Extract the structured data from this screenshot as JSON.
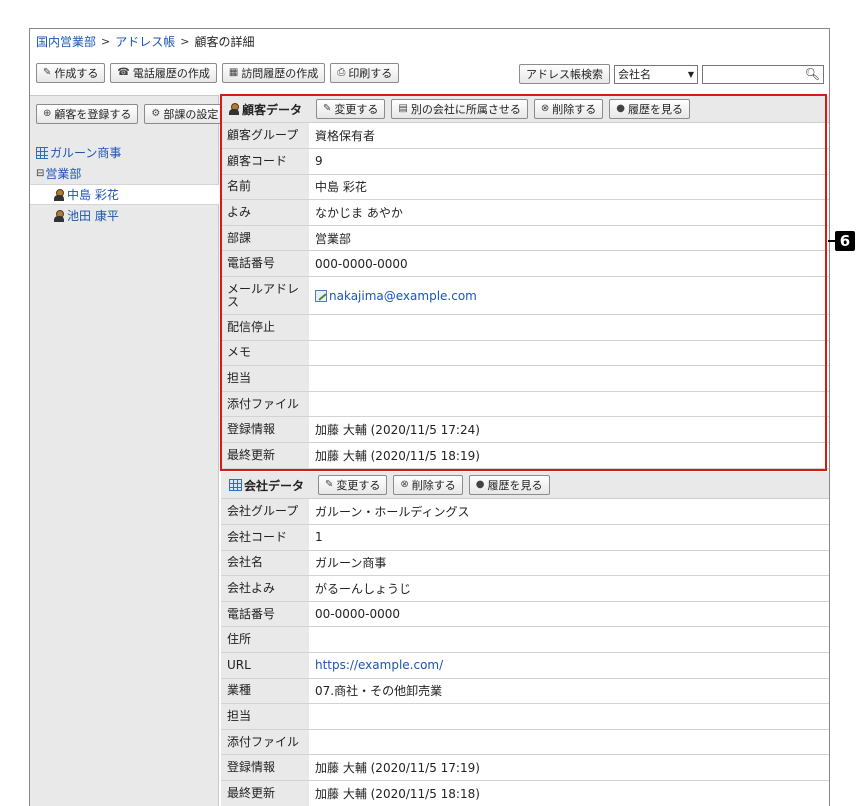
{
  "breadcrumb": {
    "items": [
      "国内営業部",
      "アドレス帳"
    ],
    "current": "顧客の詳細"
  },
  "toolbar": {
    "create": "作成する",
    "phone_history": "電話履歴の作成",
    "visit_history": "訪問履歴の作成",
    "print": "印刷する"
  },
  "search": {
    "button": "アドレス帳検索",
    "select_value": "会社名",
    "input_value": ""
  },
  "sidebar": {
    "register_customer": "顧客を登録する",
    "department_settings": "部課の設定",
    "tree": {
      "company": "ガルーン商事",
      "department": "営業部",
      "people": [
        "中島 彩花",
        "池田 康平"
      ]
    }
  },
  "customer": {
    "title": "顧客データ",
    "buttons": {
      "edit": "変更する",
      "move": "別の会社に所属させる",
      "delete": "削除する",
      "history": "履歴を見る"
    },
    "fields": [
      {
        "label": "顧客グループ",
        "value": "資格保有者"
      },
      {
        "label": "顧客コード",
        "value": "9"
      },
      {
        "label": "名前",
        "value": "中島 彩花"
      },
      {
        "label": "よみ",
        "value": "なかじま あやか"
      },
      {
        "label": "部課",
        "value": "営業部"
      },
      {
        "label": "電話番号",
        "value": "000-0000-0000"
      },
      {
        "label": "メールアドレス",
        "value": "nakajima@example.com"
      },
      {
        "label": "配信停止",
        "value": ""
      },
      {
        "label": "メモ",
        "value": ""
      },
      {
        "label": "担当",
        "value": ""
      },
      {
        "label": "添付ファイル",
        "value": ""
      },
      {
        "label": "登録情報",
        "value": "加藤 大輔 (2020/11/5 17:24)"
      },
      {
        "label": "最終更新",
        "value": "加藤 大輔 (2020/11/5 18:19)"
      }
    ]
  },
  "company": {
    "title": "会社データ",
    "buttons": {
      "edit": "変更する",
      "delete": "削除する",
      "history": "履歴を見る"
    },
    "fields": [
      {
        "label": "会社グループ",
        "value": "ガルーン・ホールディングス"
      },
      {
        "label": "会社コード",
        "value": "1"
      },
      {
        "label": "会社名",
        "value": "ガルーン商事"
      },
      {
        "label": "会社よみ",
        "value": "がるーんしょうじ"
      },
      {
        "label": "電話番号",
        "value": "00-0000-0000"
      },
      {
        "label": "住所",
        "value": ""
      },
      {
        "label": "URL",
        "value": "https://example.com/"
      },
      {
        "label": "業種",
        "value": "07.商社・その他卸売業"
      },
      {
        "label": "担当",
        "value": ""
      },
      {
        "label": "添付ファイル",
        "value": ""
      },
      {
        "label": "登録情報",
        "value": "加藤 大輔 (2020/11/5 17:19)"
      },
      {
        "label": "最終更新",
        "value": "加藤 大輔 (2020/11/5 18:18)"
      }
    ]
  },
  "annotation": {
    "badge": "6",
    "highlight_color": "#d51a1a"
  }
}
